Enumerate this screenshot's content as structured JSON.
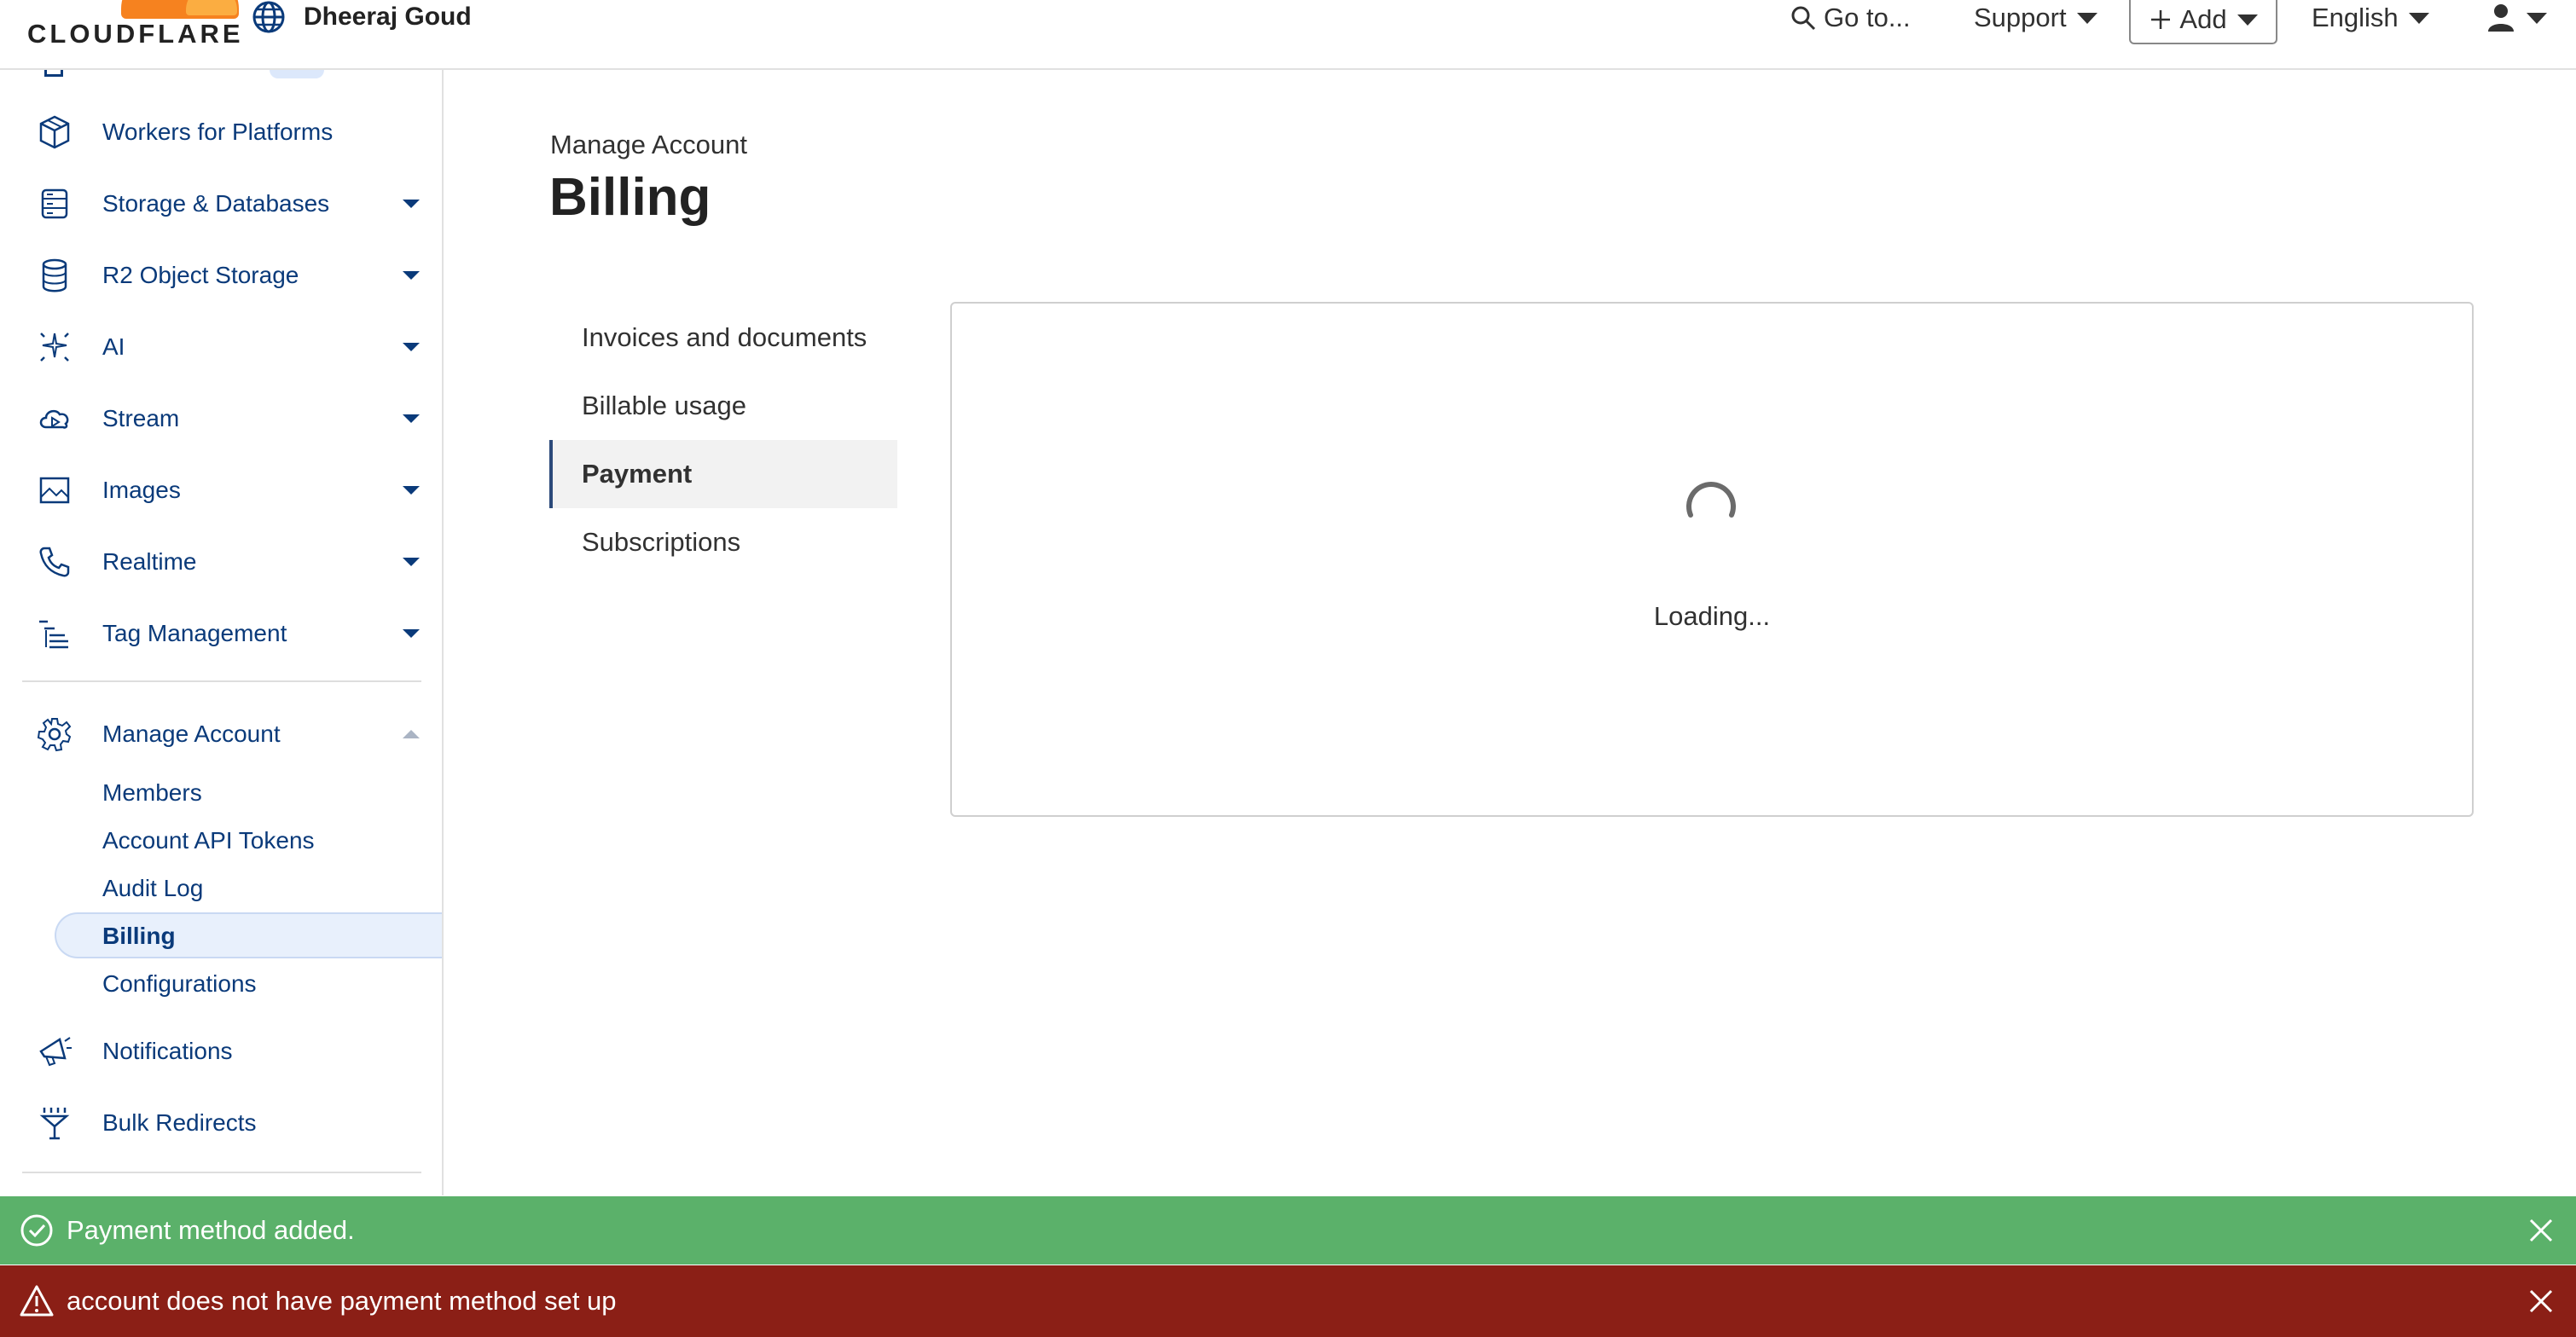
{
  "topbar": {
    "logo_text": "CLOUDFLARE",
    "account_name": "Dheeraj Goud",
    "goto_label": "Go to...",
    "support_label": "Support",
    "add_label": "Add",
    "language_label": "English"
  },
  "sidebar": {
    "items": [
      {
        "label": "Workers for Platforms",
        "icon": "cube-icon"
      },
      {
        "label": "Storage & Databases",
        "icon": "storage-icon",
        "expandable": true
      },
      {
        "label": "R2 Object Storage",
        "icon": "database-icon",
        "expandable": true
      },
      {
        "label": "AI",
        "icon": "sparkle-icon",
        "expandable": true
      },
      {
        "label": "Stream",
        "icon": "cloud-play-icon",
        "expandable": true
      },
      {
        "label": "Images",
        "icon": "image-icon",
        "expandable": true
      },
      {
        "label": "Realtime",
        "icon": "phone-icon",
        "expandable": true
      },
      {
        "label": "Tag Management",
        "icon": "tag-management-icon",
        "expandable": true
      }
    ],
    "manage_account": {
      "label": "Manage Account",
      "icon": "gear-icon",
      "expanded": true,
      "children": [
        "Members",
        "Account API Tokens",
        "Audit Log",
        "Billing",
        "Configurations"
      ],
      "active_child": "Billing"
    },
    "bottom_items": [
      {
        "label": "Notifications",
        "icon": "megaphone-icon"
      },
      {
        "label": "Bulk Redirects",
        "icon": "redirect-icon"
      }
    ]
  },
  "main": {
    "breadcrumb": "Manage Account",
    "title": "Billing",
    "subnav": [
      "Invoices and documents",
      "Billable usage",
      "Payment",
      "Subscriptions"
    ],
    "active_subnav": "Payment",
    "loading_text": "Loading..."
  },
  "toasts": [
    {
      "type": "success",
      "text": "Payment method added.",
      "color": "#5bb16a"
    },
    {
      "type": "error",
      "text": "account does not have payment method set up",
      "color": "#8b1f16"
    }
  ],
  "colors": {
    "brand_orange": "#f6821f",
    "nav_text": "#0a3a7a",
    "active_bg": "#e8f0fc"
  }
}
